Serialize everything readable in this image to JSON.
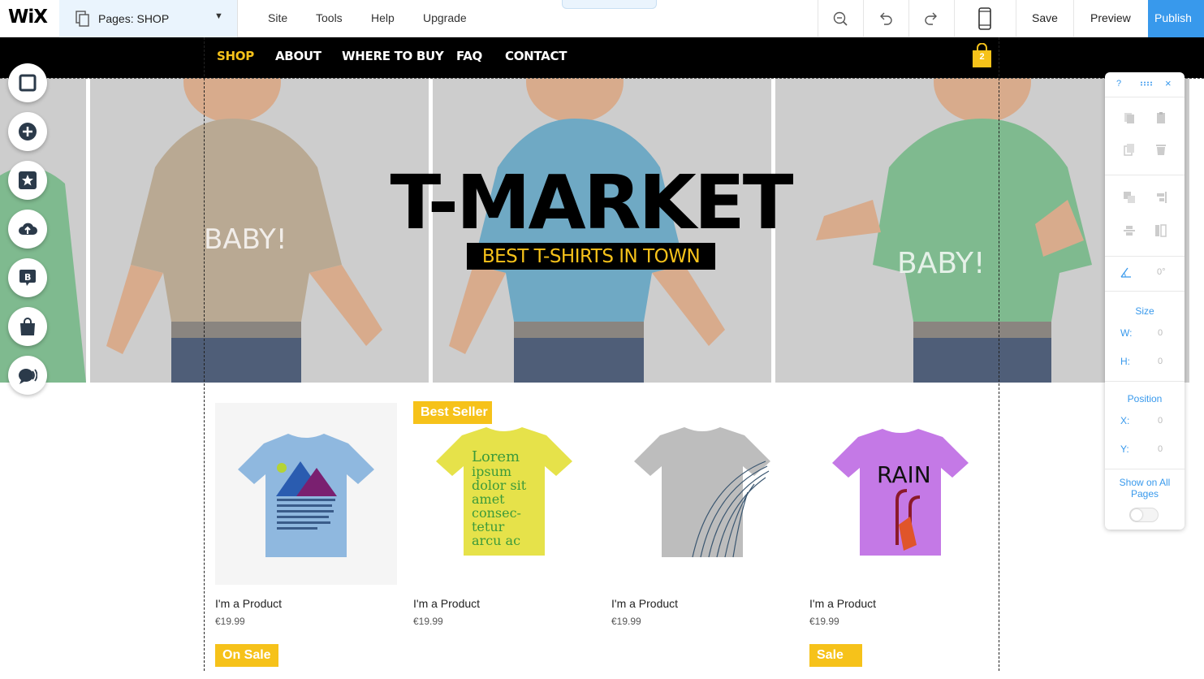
{
  "topbar": {
    "logo": "WiX",
    "pages_label": "Pages: SHOP",
    "menu": [
      "Site",
      "Tools",
      "Help",
      "Upgrade"
    ],
    "save": "Save",
    "preview": "Preview",
    "publish": "Publish",
    "accent": "#3899ec"
  },
  "site_nav": {
    "items": [
      "SHOP",
      "ABOUT",
      "WHERE TO BUY",
      "FAQ",
      "CONTACT"
    ],
    "active_color": "#f6c21a",
    "cart_count": "2"
  },
  "hero": {
    "title": "T-MARKET",
    "subtitle": "BEST T-SHIRTS IN TOWN",
    "panels": [
      {
        "shirt_color": "#b9a993",
        "print": "THATS MY BABY!"
      },
      {
        "shirt_color": "#6fa9c4",
        "print": ""
      },
      {
        "shirt_color": "#7fba8f",
        "print": "YES, THATS MY BABY!"
      }
    ]
  },
  "left_toolbar": [
    "background-icon",
    "add-icon",
    "star-icon",
    "upload-icon",
    "blog-icon",
    "store-icon",
    "chat-icon"
  ],
  "products": [
    {
      "name": "I'm a Product",
      "price": "€19.99",
      "ribbon_top": "",
      "ribbon_bottom": "On Sale",
      "shirt_color": "#8fb8df",
      "print": "mountains"
    },
    {
      "name": "I'm a Product",
      "price": "€19.99",
      "ribbon_top": "Best Seller",
      "ribbon_bottom": "",
      "shirt_color": "#e6e24a",
      "print": "Lorem ipsum dolor sit amet consectetur adipiscing elit fusce tempor arcu ac"
    },
    {
      "name": "I'm a Product",
      "price": "€19.99",
      "ribbon_top": "",
      "ribbon_bottom": "",
      "shirt_color": "#bdbdbd",
      "print": "lines"
    },
    {
      "name": "I'm a Product",
      "price": "€19.99",
      "ribbon_top": "",
      "ribbon_bottom": "Sale",
      "shirt_color": "#c479e6",
      "print": "RAIN"
    }
  ],
  "inspector": {
    "help": "?",
    "angle": "0°",
    "size_label": "Size",
    "w_key": "W:",
    "w_val": "0",
    "h_key": "H:",
    "h_val": "0",
    "position_label": "Position",
    "x_key": "X:",
    "x_val": "0",
    "y_key": "Y:",
    "y_val": "0",
    "show_all_pages": "Show on All Pages"
  }
}
